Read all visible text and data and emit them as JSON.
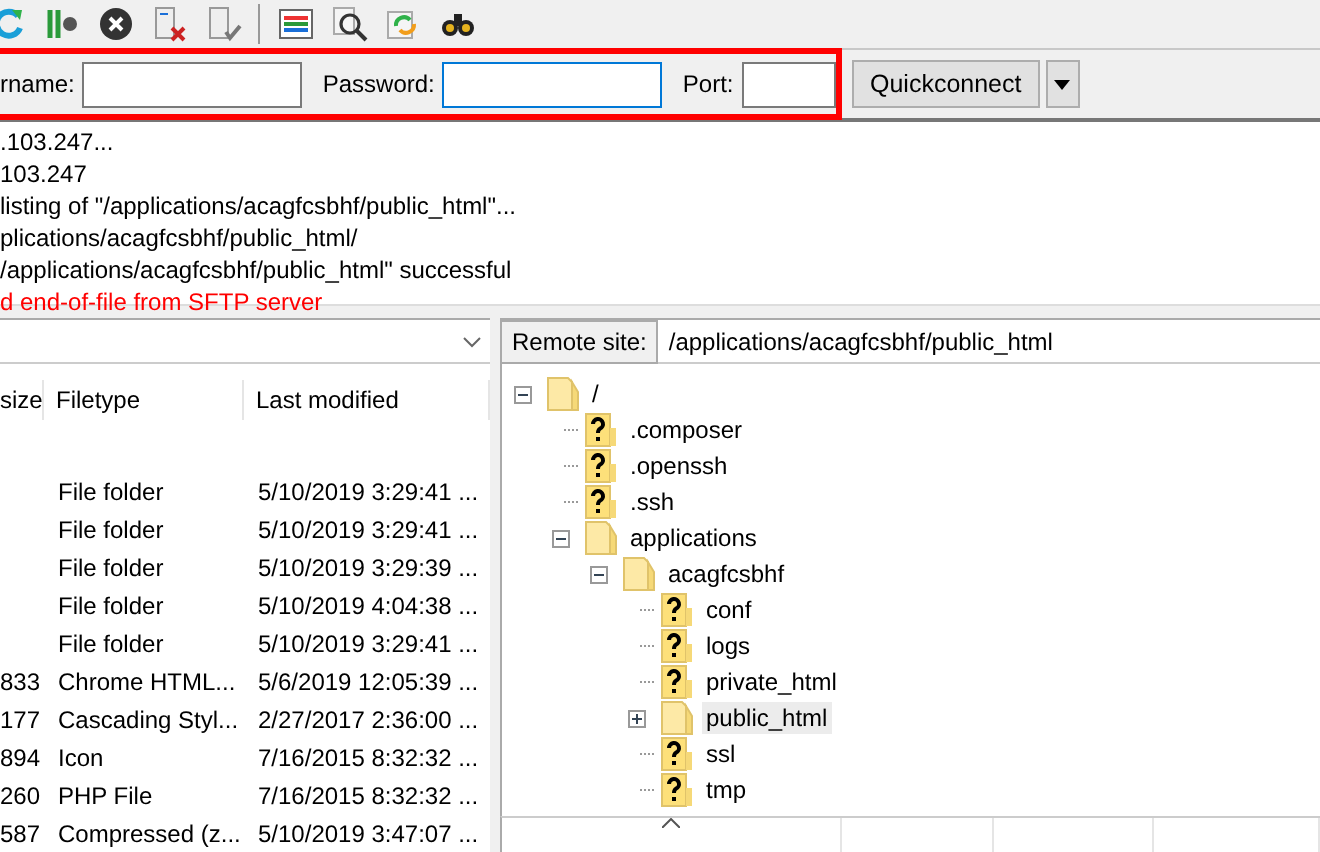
{
  "toolbar": {
    "buttons": [
      {
        "kind": "refresh"
      },
      {
        "kind": "queue"
      },
      {
        "kind": "cancel"
      },
      {
        "kind": "disconnect"
      },
      {
        "kind": "reconnect"
      },
      {
        "kind": "separator"
      },
      {
        "kind": "filelist"
      },
      {
        "kind": "search"
      },
      {
        "kind": "sync"
      },
      {
        "kind": "find"
      }
    ]
  },
  "quickconnect": {
    "highlighted": true,
    "fields": [
      {
        "label": "rname:",
        "focused": false,
        "kind": "wide"
      },
      {
        "label": "Password:",
        "focused": true,
        "kind": "wide"
      },
      {
        "label": "Port:",
        "focused": false,
        "kind": "narrow"
      }
    ],
    "button": "Quickconnect"
  },
  "log": [
    {
      "text": ".103.247...",
      "kind": "status"
    },
    {
      "text": "103.247",
      "kind": "status"
    },
    {
      "text": "listing of \"/applications/acagfcsbhf/public_html\"...",
      "kind": "status"
    },
    {
      "text": "plications/acagfcsbhf/public_html/",
      "kind": "status"
    },
    {
      "text": "/applications/acagfcsbhf/public_html\" successful",
      "kind": "status"
    },
    {
      "text": "d end-of-file from SFTP server",
      "kind": "error"
    }
  ],
  "local": {
    "columns": [
      "size",
      "Filetype",
      "Last modified"
    ],
    "rows": [
      {
        "size": "",
        "type": "File folder",
        "modified": "5/10/2019 3:29:41 ..."
      },
      {
        "size": "",
        "type": "File folder",
        "modified": "5/10/2019 3:29:41 ..."
      },
      {
        "size": "",
        "type": "File folder",
        "modified": "5/10/2019 3:29:39 ..."
      },
      {
        "size": "",
        "type": "File folder",
        "modified": "5/10/2019 4:04:38 ..."
      },
      {
        "size": "",
        "type": "File folder",
        "modified": "5/10/2019 3:29:41 ..."
      },
      {
        "size": "833",
        "type": "Chrome HTML...",
        "modified": "5/6/2019 12:05:39 ..."
      },
      {
        "size": "177",
        "type": "Cascading Styl...",
        "modified": "2/27/2017 2:36:00 ..."
      },
      {
        "size": "894",
        "type": "Icon",
        "modified": "7/16/2015 8:32:32 ..."
      },
      {
        "size": "260",
        "type": "PHP File",
        "modified": "7/16/2015 8:32:32 ..."
      },
      {
        "size": "587",
        "type": "Compressed (z...",
        "modified": "5/10/2019 3:47:07 ..."
      }
    ]
  },
  "remote": {
    "label": "Remote site:",
    "path": "/applications/acagfcsbhf/public_html",
    "tree": [
      {
        "name": "/",
        "kind": "folder",
        "expanded": true,
        "selected": false,
        "children": [
          {
            "name": ".composer",
            "kind": "unknown",
            "selected": false
          },
          {
            "name": ".openssh",
            "kind": "unknown",
            "selected": false
          },
          {
            "name": ".ssh",
            "kind": "unknown",
            "selected": false
          },
          {
            "name": "applications",
            "kind": "folder",
            "expanded": true,
            "selected": false,
            "children": [
              {
                "name": "acagfcsbhf",
                "kind": "folder",
                "expanded": true,
                "selected": false,
                "children": [
                  {
                    "name": "conf",
                    "kind": "unknown",
                    "selected": false
                  },
                  {
                    "name": "logs",
                    "kind": "unknown",
                    "selected": false
                  },
                  {
                    "name": "private_html",
                    "kind": "unknown",
                    "selected": false
                  },
                  {
                    "name": "public_html",
                    "kind": "folder",
                    "expanded": false,
                    "selected": true
                  },
                  {
                    "name": "ssl",
                    "kind": "unknown",
                    "selected": false
                  },
                  {
                    "name": "tmp",
                    "kind": "unknown",
                    "selected": false
                  }
                ]
              }
            ]
          }
        ]
      }
    ]
  }
}
